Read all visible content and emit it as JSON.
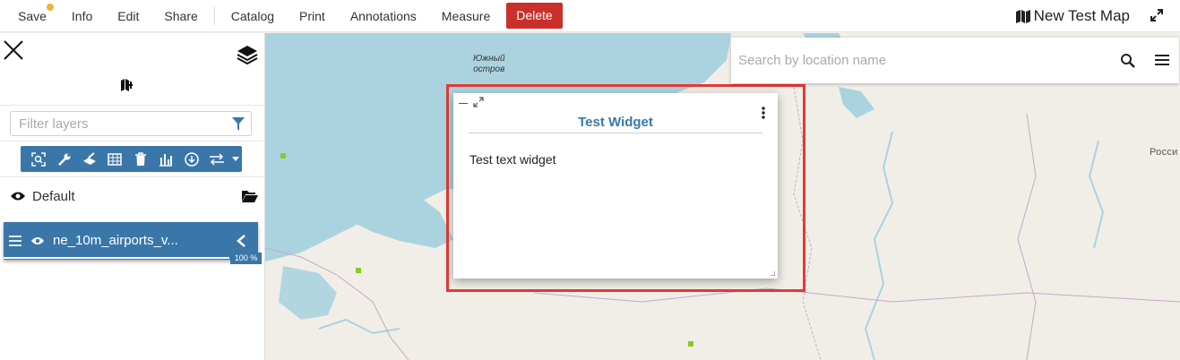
{
  "menu": {
    "save": "Save",
    "info": "Info",
    "edit": "Edit",
    "share": "Share",
    "catalog": "Catalog",
    "print": "Print",
    "annotations": "Annotations",
    "measure": "Measure",
    "delete": "Delete"
  },
  "map_title": "New Test Map",
  "search": {
    "placeholder": "Search by location name"
  },
  "toc": {
    "filter_placeholder": "Filter layers",
    "group_name": "Default",
    "layer_name": "ne_10m_airports_v...",
    "layer_opacity": "100 %"
  },
  "widget": {
    "title": "Test Widget",
    "text": "Test text widget"
  },
  "map_labels": {
    "island": "Южный\nостров",
    "country": "Росси"
  },
  "colors": {
    "accent": "#3a77a8",
    "delete": "#c9302c",
    "highlight": "#e53935",
    "water": "#aad3df",
    "airport": "#8ac926"
  },
  "icons": {
    "toolbar": [
      "zoom-to-icon",
      "settings-wrench-icon",
      "style-brush-icon",
      "attribute-table-icon",
      "delete-trash-icon",
      "widgets-chart-icon",
      "download-icon",
      "swap-icon",
      "caret-down-icon"
    ]
  }
}
